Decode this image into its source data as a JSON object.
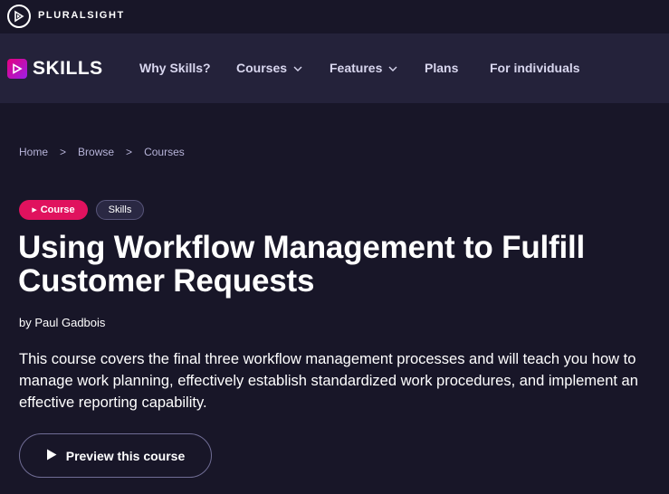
{
  "brand": {
    "pluralsight": "PLURALSIGHT",
    "skills": "SKILLS"
  },
  "nav": {
    "items": [
      {
        "label": "Why Skills?"
      },
      {
        "label": "Courses",
        "has_dropdown": true
      },
      {
        "label": "Features",
        "has_dropdown": true
      },
      {
        "label": "Plans"
      },
      {
        "label": "For individuals"
      }
    ]
  },
  "breadcrumb": {
    "items": [
      "Home",
      "Browse",
      "Courses"
    ],
    "separator": ">"
  },
  "tags": {
    "course": "Course",
    "skills": "Skills"
  },
  "course": {
    "title": "Using Workflow Management to Fulfill Customer Requests",
    "author": "by Paul Gadbois",
    "description": "This course covers the final three workflow management processes and will teach you how to manage work planning, effectively establish standardized work procedures, and implement an effective reporting capability.",
    "preview_label": "Preview this course"
  },
  "colors": {
    "background": "#181628",
    "nav_background": "#24223a",
    "accent_pink": "#e0125e",
    "breadcrumb": "#b6b3d8"
  }
}
